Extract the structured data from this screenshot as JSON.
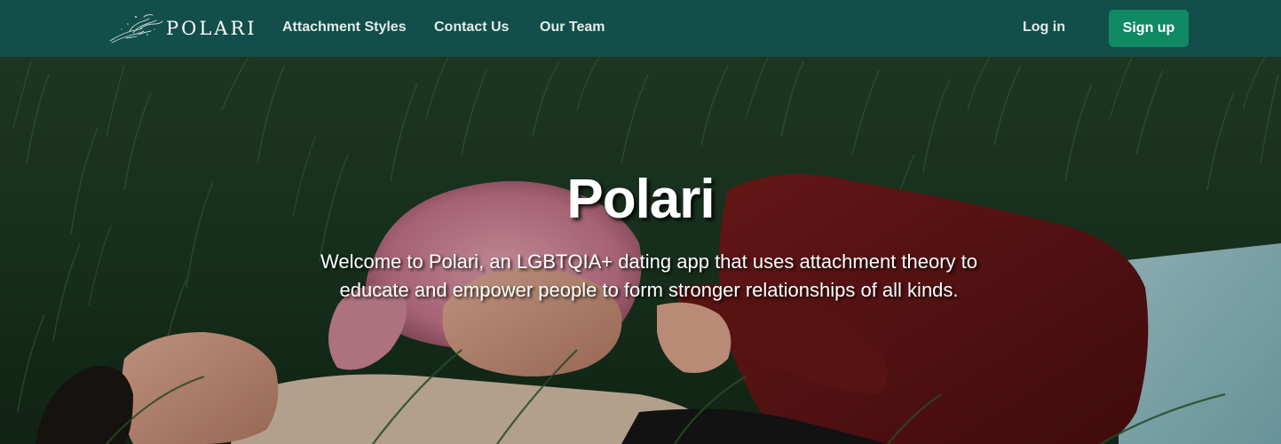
{
  "navbar": {
    "brand_name": "POLARI",
    "links": [
      {
        "label": "Attachment Styles"
      },
      {
        "label": "Contact Us"
      },
      {
        "label": "Our Team"
      }
    ],
    "login_label": "Log in",
    "signup_label": "Sign up"
  },
  "hero": {
    "title": "Polari",
    "subtitle": "Welcome to Polari, an LGBTQIA+ dating app that uses attachment theory to educate and empower people to form stronger relationships of all kinds."
  },
  "colors": {
    "navbar_bg": "#124e4a",
    "signup_bg": "#108a64",
    "text_on_dark": "#ffffff"
  }
}
